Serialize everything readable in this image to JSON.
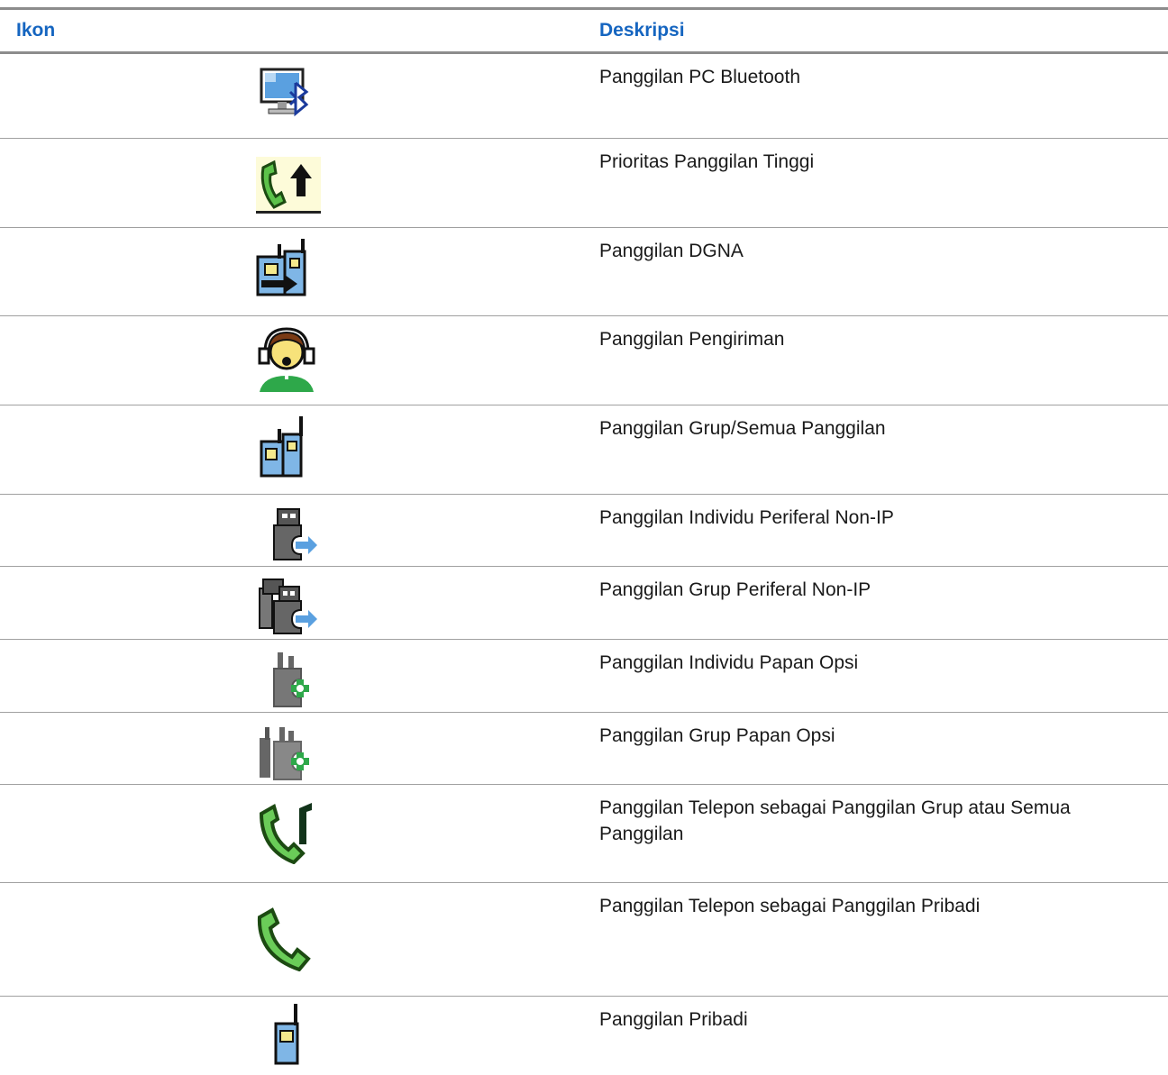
{
  "table": {
    "headers": {
      "icon": "Ikon",
      "description": "Deskripsi"
    },
    "rows": [
      {
        "icon": "bluetooth-pc-call-icon",
        "description": "Panggilan PC Bluetooth"
      },
      {
        "icon": "high-priority-call-icon",
        "description": "Prioritas Panggilan Tinggi"
      },
      {
        "icon": "dgna-call-icon",
        "description": "Panggilan DGNA"
      },
      {
        "icon": "dispatch-call-icon",
        "description": "Panggilan Pengiriman"
      },
      {
        "icon": "group-all-call-icon",
        "description": "Panggilan Grup/Semua Panggilan"
      },
      {
        "icon": "non-ip-peripheral-individual-call-icon",
        "description": "Panggilan Individu Periferal Non-IP"
      },
      {
        "icon": "non-ip-peripheral-group-call-icon",
        "description": "Panggilan Grup Periferal Non-IP"
      },
      {
        "icon": "option-board-individual-call-icon",
        "description": "Panggilan Individu Papan Opsi"
      },
      {
        "icon": "option-board-group-call-icon",
        "description": "Panggilan Grup Papan Opsi"
      },
      {
        "icon": "phone-group-call-icon",
        "description": "Panggilan Telepon sebagai Panggilan Grup atau Semua Panggilan"
      },
      {
        "icon": "phone-private-call-icon",
        "description": "Panggilan Telepon sebagai Panggilan Pribadi"
      },
      {
        "icon": "private-call-icon",
        "description": "Panggilan Pribadi"
      }
    ]
  }
}
